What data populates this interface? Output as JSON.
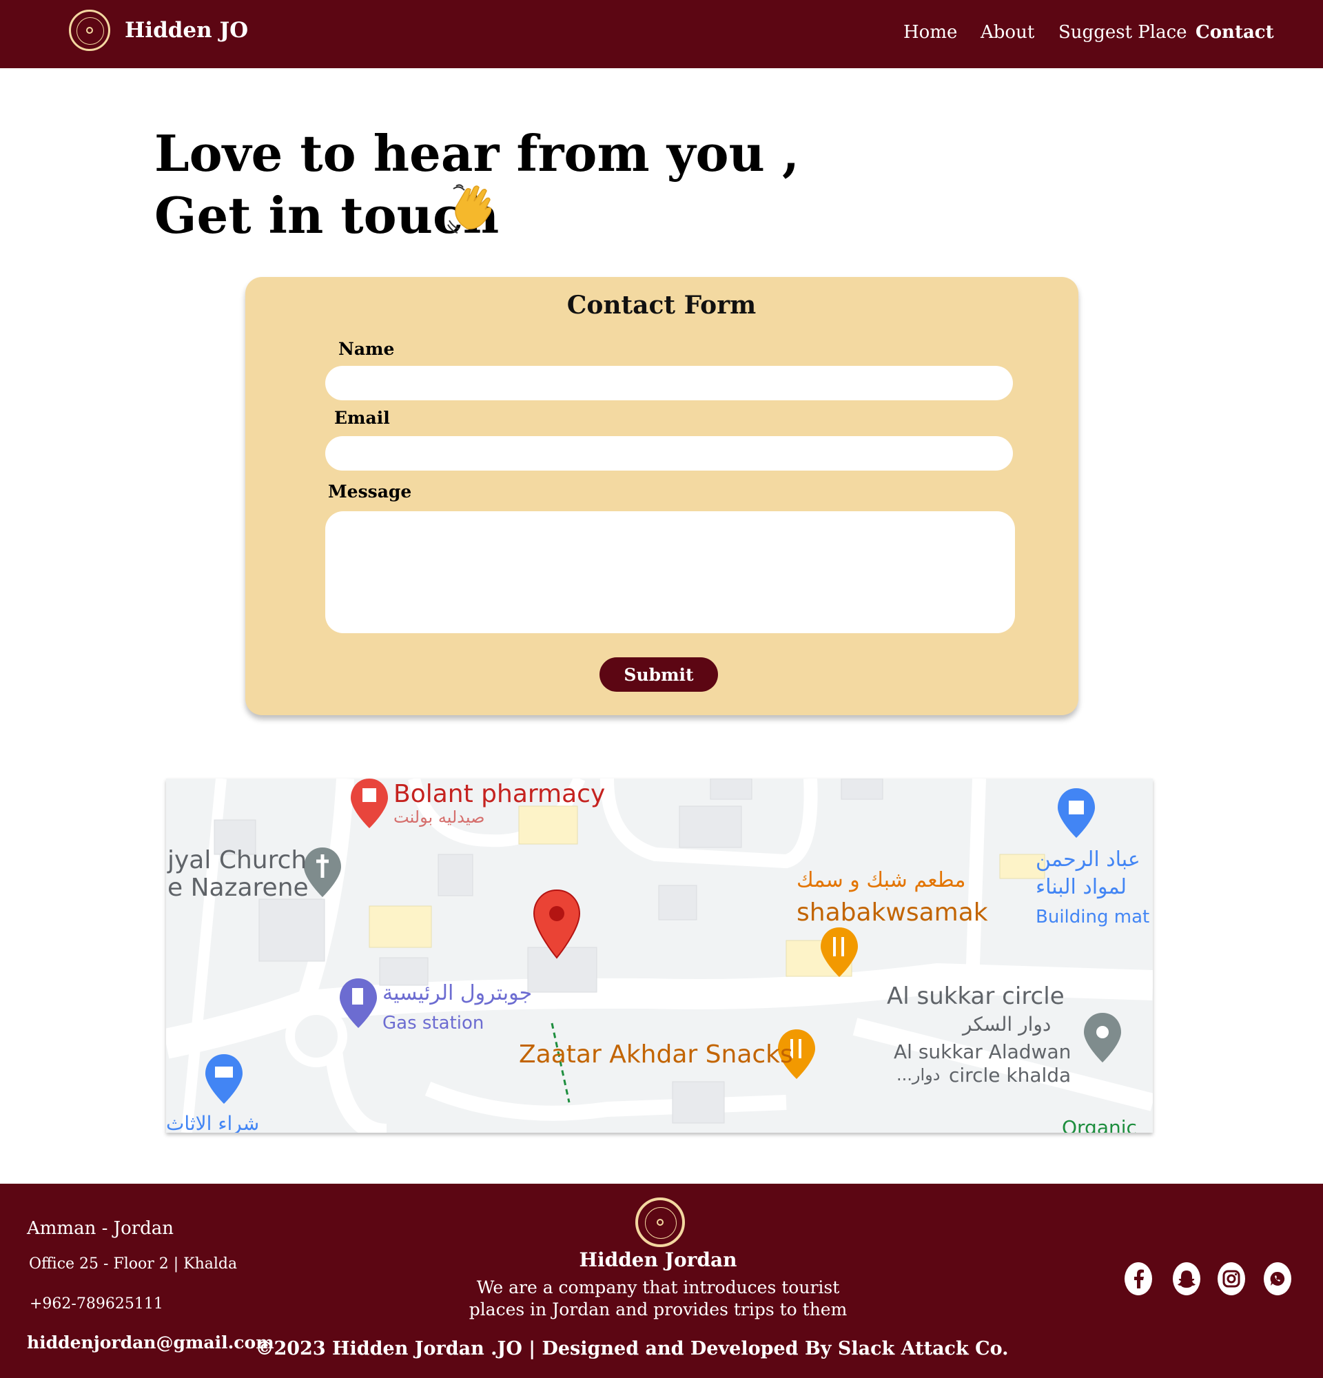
{
  "nav": {
    "brand": "Hidden JO",
    "links": [
      "Home",
      "About",
      "Suggest Place",
      "Contact"
    ],
    "active": "Contact"
  },
  "hero": {
    "line1": "Love to hear from you ,",
    "line2": "Get in touch",
    "emoji_icon": "waving-hand-icon"
  },
  "form": {
    "title": "Contact Form",
    "name_label": "Name",
    "email_label": "Email",
    "message_label": "Message",
    "name_value": "",
    "email_value": "",
    "message_value": "",
    "submit_label": "Submit"
  },
  "map": {
    "labels": {
      "pharmacy": "Bolant pharmacy",
      "pharmacy_ar": "صيدليه بولنت",
      "church_1": "ijyal Church",
      "church_2": "ie Nazarene",
      "restaurant_ar": "مطعم شبك و سمك",
      "restaurant": "shabakwsamak",
      "store_ar_1": "عباد الرحمن",
      "store_ar_2": "لمواد البناء",
      "store": "Building mat",
      "gas_ar": "جوبترول الرئيسية",
      "gas": "Gas station",
      "circle": "Al sukkar circle",
      "circle_ar": "دوار السكر",
      "circle_2": "Al sukkar Aladwan",
      "circle_3": "circle khalda",
      "circle_3_ar": "...دوار",
      "snacks": "Zaatar Akhdar Snacks",
      "shop_ar": "شراء الاثاث",
      "organic": "Organic"
    }
  },
  "footer": {
    "city": "Amman - Jordan",
    "office": "Office 25 - Floor 2 | Khalda",
    "phone": "+962-789625111",
    "email": "hiddenjordan@gmail.com",
    "company": "Hidden Jordan",
    "desc_1": "We are a company that introduces tourist",
    "desc_2": "places in Jordan and provides trips to them",
    "copyright": "©2023 Hidden Jordan .JO | Designed and Developed By Slack Attack Co.",
    "social_icons": [
      "facebook-icon",
      "snapchat-icon",
      "instagram-icon",
      "whatsapp-icon"
    ]
  },
  "colors": {
    "primary": "#5c0613",
    "card": "#f3d9a1",
    "accent": "#f3d7a0"
  }
}
